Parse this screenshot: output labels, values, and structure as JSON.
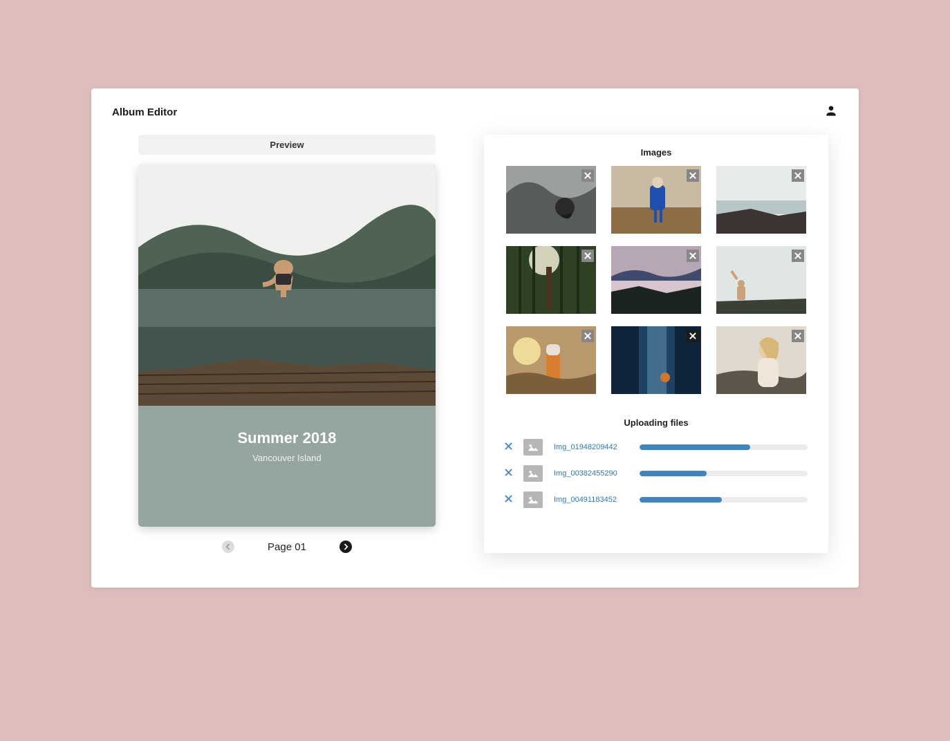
{
  "header": {
    "title": "Album Editor"
  },
  "preview": {
    "tab_label": "Preview",
    "title": "Summer 2018",
    "subtitle": "Vancouver Island",
    "page_label": "Page 01"
  },
  "images": {
    "heading": "Images",
    "thumbs": [
      {
        "id": "thumb-1"
      },
      {
        "id": "thumb-2"
      },
      {
        "id": "thumb-3"
      },
      {
        "id": "thumb-4"
      },
      {
        "id": "thumb-5"
      },
      {
        "id": "thumb-6"
      },
      {
        "id": "thumb-7"
      },
      {
        "id": "thumb-8"
      },
      {
        "id": "thumb-9"
      }
    ]
  },
  "uploading": {
    "heading": "Uploading files",
    "files": [
      {
        "name": "Img_01948209442",
        "progress": 66
      },
      {
        "name": "Img_00382455290",
        "progress": 40
      },
      {
        "name": "Img_00491183452",
        "progress": 49
      }
    ]
  }
}
